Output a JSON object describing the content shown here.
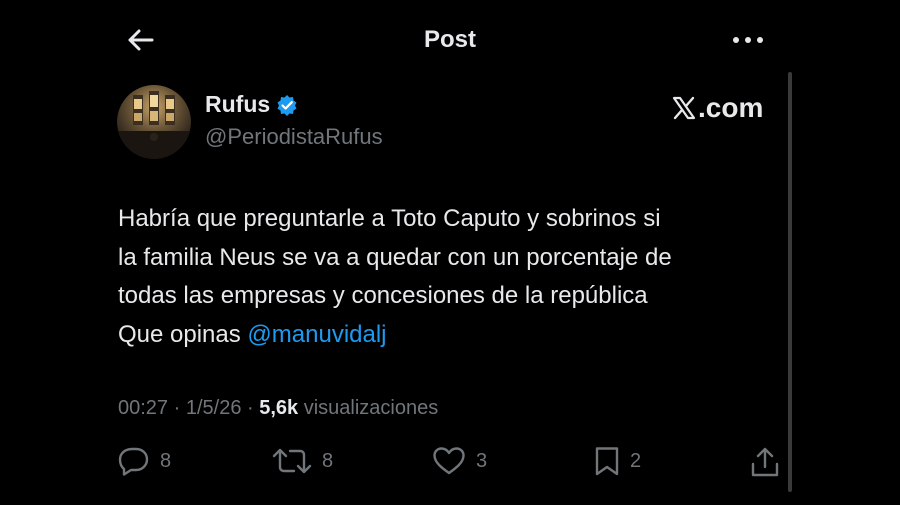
{
  "header": {
    "title": "Post"
  },
  "post": {
    "author": {
      "name": "Rufus",
      "handle": "@PeriodistaRufus",
      "verified": true
    },
    "source_logo": ".com",
    "text_lines": [
      "Habría que preguntarle a Toto Caputo y sobrinos si",
      "la familia Neus se va a quedar con un porcentaje de",
      "todas las empresas y concesiones de la república"
    ],
    "text_last_prefix": "Que opinas ",
    "mention": "@manuvidalj",
    "meta": {
      "time": "00:27",
      "sep1": " · ",
      "date": "1/5/26",
      "sep2": " · ",
      "views": "5,6k",
      "views_label": " visualizaciones"
    },
    "actions": {
      "replies": "8",
      "reposts": "8",
      "likes": "3",
      "bookmarks": "2"
    }
  },
  "colors": {
    "background": "#000000",
    "text": "#e7e9ea",
    "secondary": "#71767b",
    "accent": "#1d9bf0"
  },
  "icons": {
    "back": "arrow-left-icon",
    "more": "more-horizontal-icon",
    "verified": "verified-badge-icon",
    "reply": "reply-icon",
    "repost": "repost-icon",
    "like": "heart-icon",
    "bookmark": "bookmark-icon",
    "share": "share-icon"
  }
}
